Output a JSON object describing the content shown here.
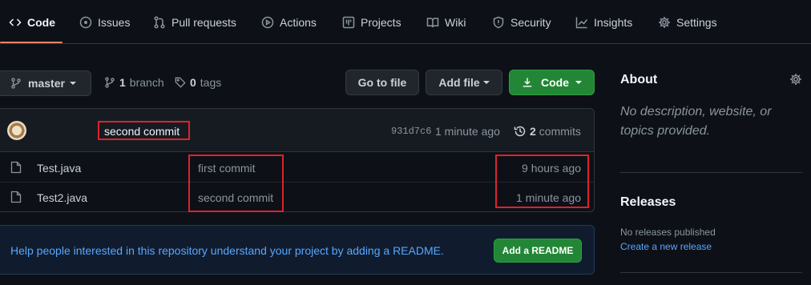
{
  "nav": {
    "tabs": [
      {
        "label": "Code",
        "icon": "code-icon"
      },
      {
        "label": "Issues",
        "icon": "issue-icon"
      },
      {
        "label": "Pull requests",
        "icon": "pull-request-icon"
      },
      {
        "label": "Actions",
        "icon": "play-icon"
      },
      {
        "label": "Projects",
        "icon": "project-icon"
      },
      {
        "label": "Wiki",
        "icon": "book-icon"
      },
      {
        "label": "Security",
        "icon": "shield-icon"
      },
      {
        "label": "Insights",
        "icon": "graph-icon"
      },
      {
        "label": "Settings",
        "icon": "gear-icon"
      }
    ]
  },
  "toolbar": {
    "branch": "master",
    "branch_count": "1",
    "branch_label": "branch",
    "tag_count": "0",
    "tag_label": "tags",
    "go_to_file": "Go to file",
    "add_file": "Add file",
    "code": "Code"
  },
  "latest_commit": {
    "message": "second commit",
    "sha": "931d7c6",
    "time": "1 minute ago",
    "commit_count": "2",
    "commit_label": "commits"
  },
  "files": [
    {
      "name": "Test.java",
      "commit": "first commit",
      "age": "9 hours ago",
      "icon": "file-icon"
    },
    {
      "name": "Test2.java",
      "commit": "second commit",
      "age": "1 minute ago",
      "icon": "file-icon"
    }
  ],
  "readme": {
    "text": "Help people interested in this repository understand your project by adding a README.",
    "button": "Add a README"
  },
  "sidebar": {
    "about_title": "About",
    "about_desc": "No description, website, or topics provided.",
    "releases_title": "Releases",
    "no_releases": "No releases published",
    "create_release": "Create a new release"
  },
  "colors": {
    "background": "#0d1117",
    "accent_green": "#238636",
    "link_blue": "#58a6ff",
    "tab_underline": "#f78166",
    "annotation_red": "#e0212b"
  }
}
